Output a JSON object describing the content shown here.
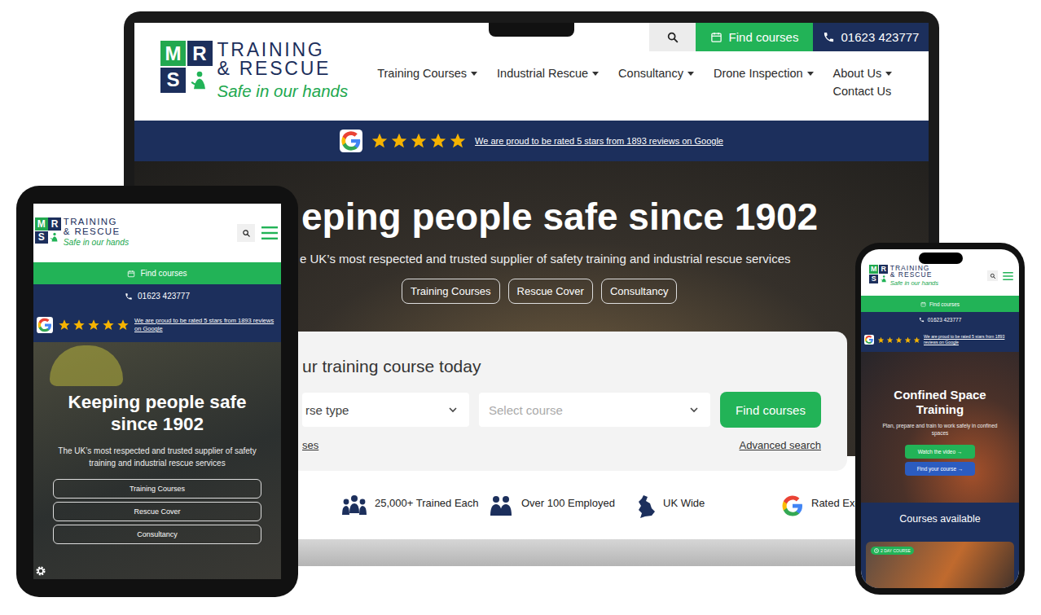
{
  "logo": {
    "letters": [
      "M",
      "R",
      "S"
    ],
    "title_lines": [
      "TRAINING",
      "& RESCUE"
    ],
    "tagline": "Safe in our hands"
  },
  "laptop": {
    "find_button": "Find courses",
    "phone": "01623 423777",
    "nav": [
      {
        "label": "Training Courses",
        "dropdown": true
      },
      {
        "label": "Industrial Rescue",
        "dropdown": true
      },
      {
        "label": "Consultancy",
        "dropdown": true
      },
      {
        "label": "Drone Inspection",
        "dropdown": true
      },
      {
        "label": "About Us",
        "dropdown": true
      },
      {
        "label": "Contact Us",
        "dropdown": false
      }
    ],
    "reviews": {
      "stars": 5,
      "text": "We are proud to be rated 5 stars from 1893 reviews on Google"
    },
    "hero": {
      "heading": "eping people safe since 1902",
      "subtitle": "e UK’s most respected and trusted supplier of safety training and industrial rescue services",
      "buttons": [
        "Training Courses",
        "Rescue Cover",
        "Consultancy"
      ]
    },
    "search_card": {
      "title": "ur training course today",
      "fields": [
        {
          "value": "rse type",
          "placeholder": false
        },
        {
          "value": "Select course",
          "placeholder": true
        }
      ],
      "button": "Find courses",
      "links": [
        "ses",
        "Advanced search"
      ]
    },
    "stats": [
      "25,000+ Trained Each",
      "Over 100 Employed",
      "UK Wide",
      "Rated Excelle"
    ]
  },
  "tablet": {
    "find_button": "Find courses",
    "phone": "01623 423777",
    "reviews": {
      "stars": 5,
      "text": "We are proud to be rated 5 stars from 1893 reviews on Google"
    },
    "hero": {
      "heading": "Keeping people safe since 1902",
      "subtitle": "The UK’s most respected and trusted supplier of safety training and industrial rescue services",
      "buttons": [
        "Training Courses",
        "Rescue Cover",
        "Consultancy"
      ]
    }
  },
  "phone": {
    "find_button": "Find courses",
    "phone": "01623 423777",
    "reviews": {
      "stars": 5,
      "text": "We are proud to be rated 5 stars from 1893 reviews on Google"
    },
    "hero": {
      "heading": "Confined Space Training",
      "subtitle": "Plan, prepare and train to work safely in confined spaces",
      "buttons": [
        {
          "label": "Watch the video →",
          "color": "#22b357"
        },
        {
          "label": "Find your course →",
          "color": "#2b5cc0"
        }
      ]
    },
    "section_title": "Courses available",
    "course_badge": "2 DAY COURSE"
  }
}
